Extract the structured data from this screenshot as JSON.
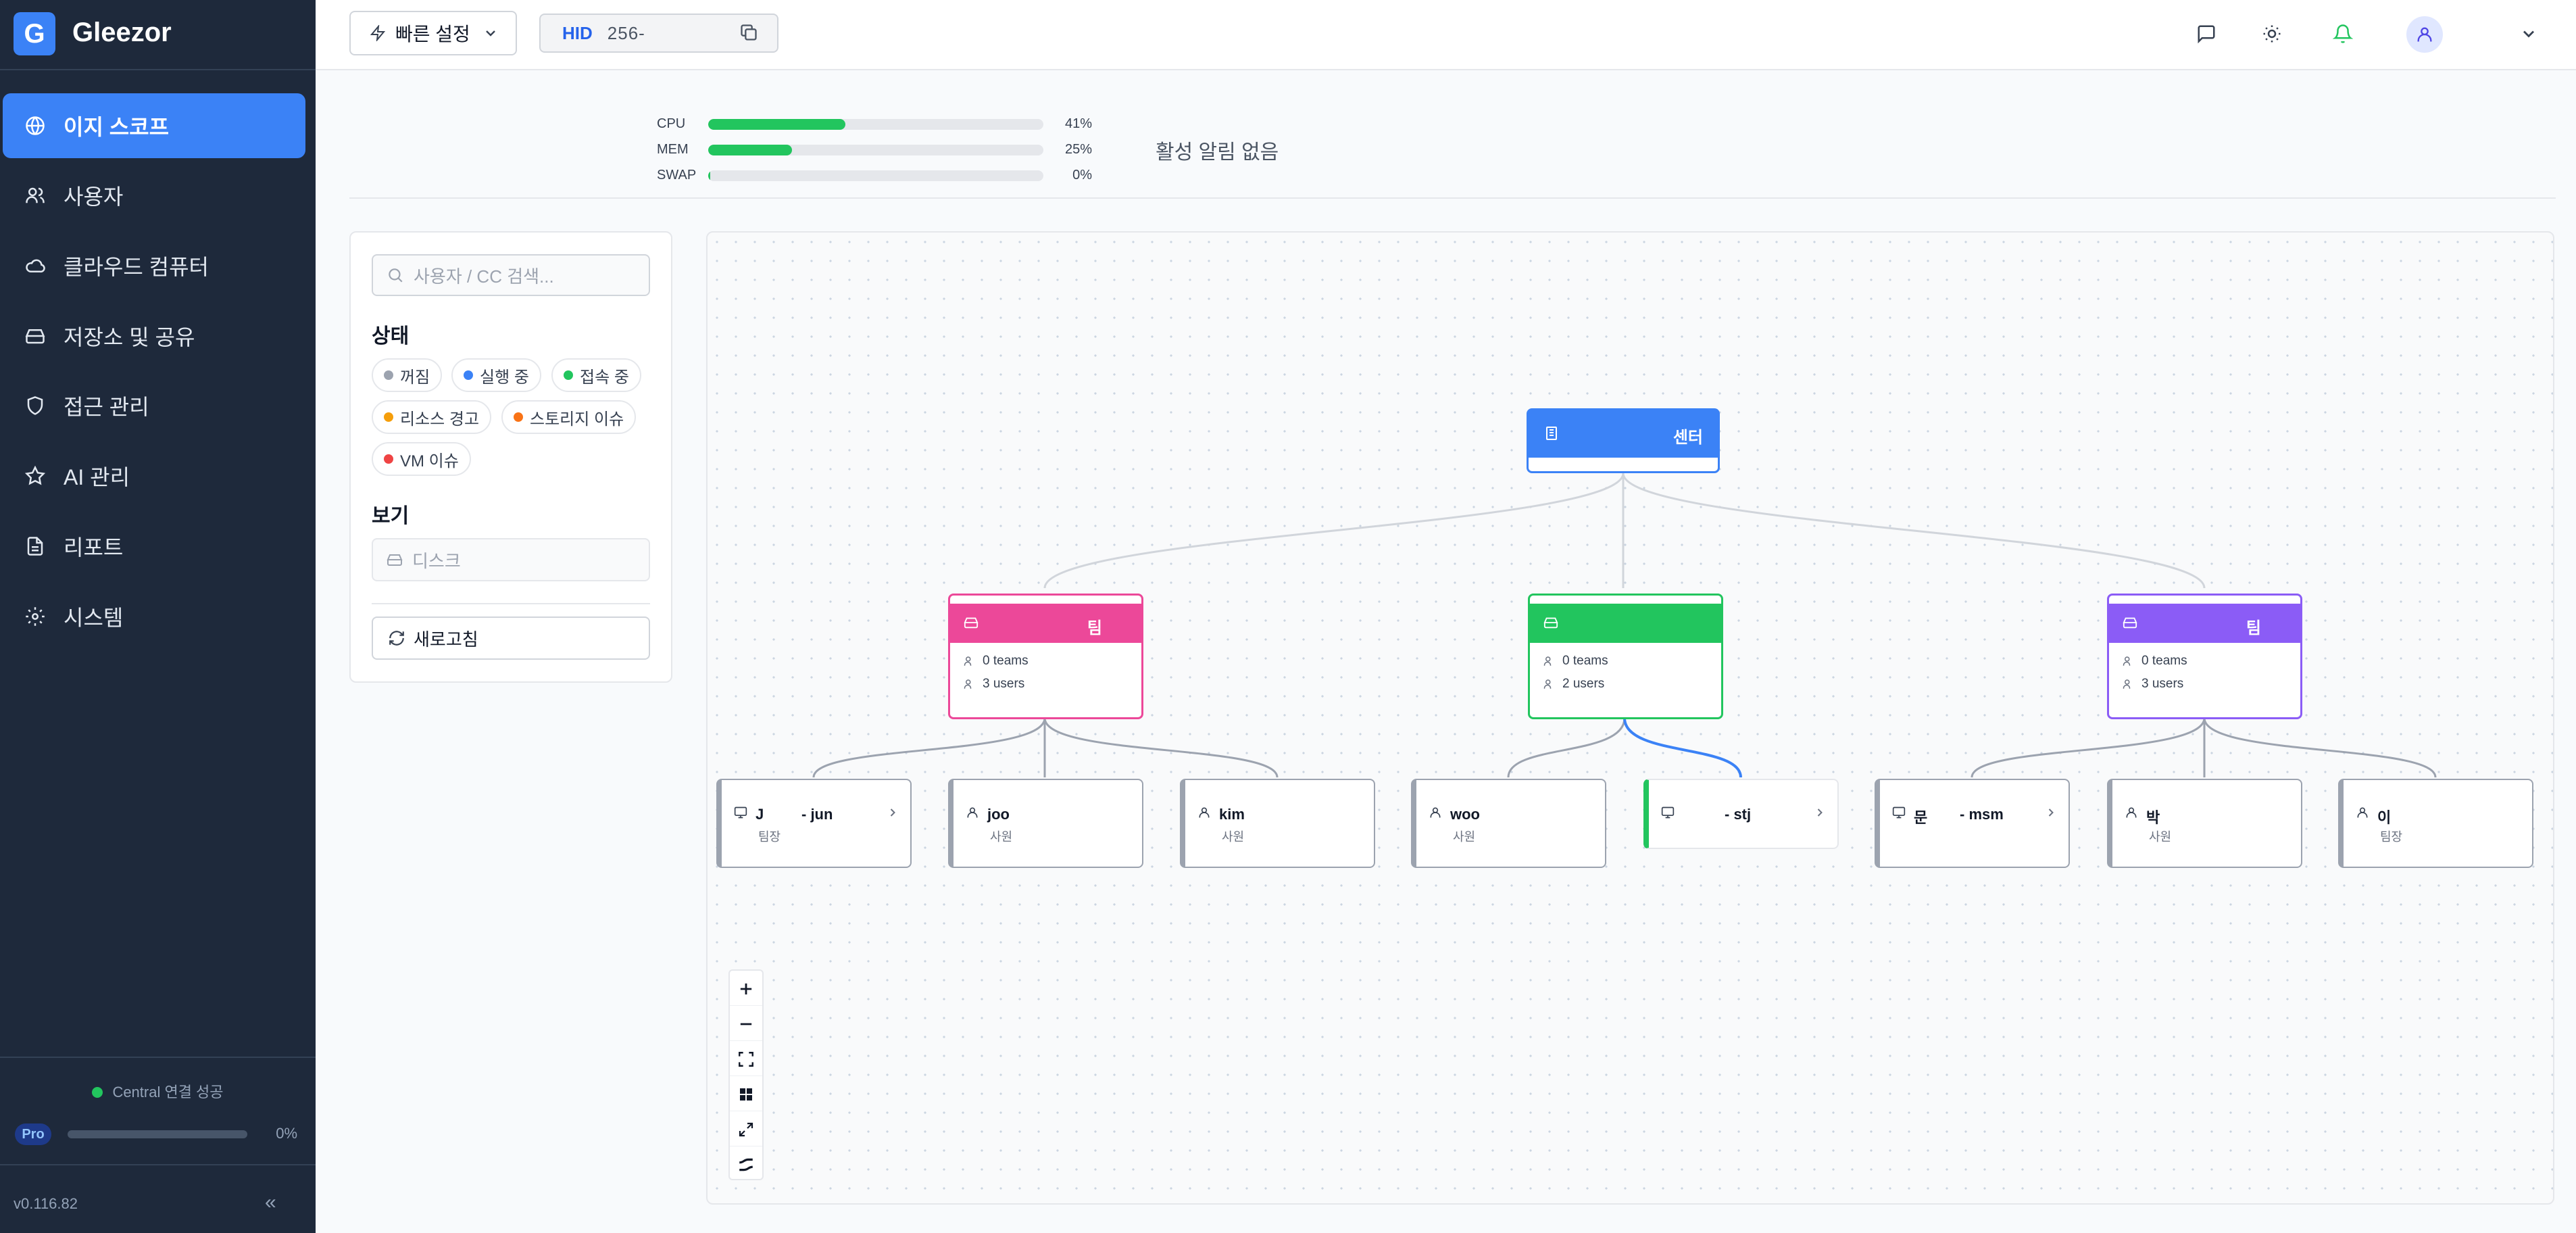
{
  "app": {
    "brand": "Gleezor",
    "logo_letter": "G",
    "version": "v0.116.82"
  },
  "sidebar": {
    "items": [
      {
        "label": "이지 스코프",
        "icon": "globe-icon",
        "active": true
      },
      {
        "label": "사용자",
        "icon": "users-icon"
      },
      {
        "label": "클라우드 컴퓨터",
        "icon": "cloud-icon"
      },
      {
        "label": "저장소 및 공유",
        "icon": "hard-drive-icon"
      },
      {
        "label": "접근 관리",
        "icon": "shield-icon"
      },
      {
        "label": "AI 관리",
        "icon": "star-icon"
      },
      {
        "label": "리포트",
        "icon": "file-text-icon"
      },
      {
        "label": "시스템",
        "icon": "gear-icon"
      }
    ],
    "connection": "Central 연결 성공",
    "plan": {
      "label": "Pro",
      "progress_pct": "0%",
      "progress_value": 0
    },
    "collapse_label": "«"
  },
  "topbar": {
    "quick_settings": "빠른 설정",
    "hid_label": "HID",
    "hid_value": "256-"
  },
  "stats": {
    "cpu": {
      "label": "CPU",
      "value": "41%",
      "fraction": 0.41
    },
    "mem": {
      "label": "MEM",
      "value": "25%",
      "fraction": 0.25
    },
    "swap": {
      "label": "SWAP",
      "value": "0%",
      "fraction": 0.0
    },
    "alerts": "활성 알림 없음"
  },
  "filters": {
    "search_placeholder": "사용자 / CC 검색...",
    "status_title": "상태",
    "statuses": [
      {
        "label": "꺼짐",
        "color": "#9ca3af"
      },
      {
        "label": "실행 중",
        "color": "#3b82f6"
      },
      {
        "label": "접속 중",
        "color": "#22c55e"
      },
      {
        "label": "리소스 경고",
        "color": "#f59e0b"
      },
      {
        "label": "스토리지 이슈",
        "color": "#f97316"
      },
      {
        "label": "VM 이슈",
        "color": "#ef4444"
      }
    ],
    "view_title": "보기",
    "view_disk": "디스크",
    "refresh": "새로고침"
  },
  "graph": {
    "center": {
      "label": "센터",
      "color": "#3b82f6"
    },
    "groups": [
      {
        "label": "팀",
        "color": "#ec4899",
        "teams": "0 teams",
        "users": "3 users"
      },
      {
        "label": "",
        "color": "#22c55e",
        "teams": "0 teams",
        "users": "2 users"
      },
      {
        "label": "팀",
        "color": "#8b5cf6",
        "teams": "0 teams",
        "users": "3 users"
      }
    ],
    "leaves": [
      {
        "name": "J",
        "suffix": "- jun",
        "role": "팀장",
        "kind": "computer"
      },
      {
        "name": "joo",
        "suffix": "",
        "role": "사원",
        "kind": "user"
      },
      {
        "name": "kim",
        "suffix": "",
        "role": "사원",
        "kind": "user"
      },
      {
        "name": "woo",
        "suffix": "",
        "role": "사원",
        "kind": "user"
      },
      {
        "name": "",
        "suffix": "- stj",
        "role": "",
        "kind": "computer",
        "accent": "#22c55e"
      },
      {
        "name": "문",
        "suffix": "- msm",
        "role": "",
        "kind": "computer"
      },
      {
        "name": "박",
        "suffix": "",
        "role": "사원",
        "kind": "user"
      },
      {
        "name": "이",
        "suffix": "",
        "role": "팀장",
        "kind": "user"
      }
    ]
  }
}
